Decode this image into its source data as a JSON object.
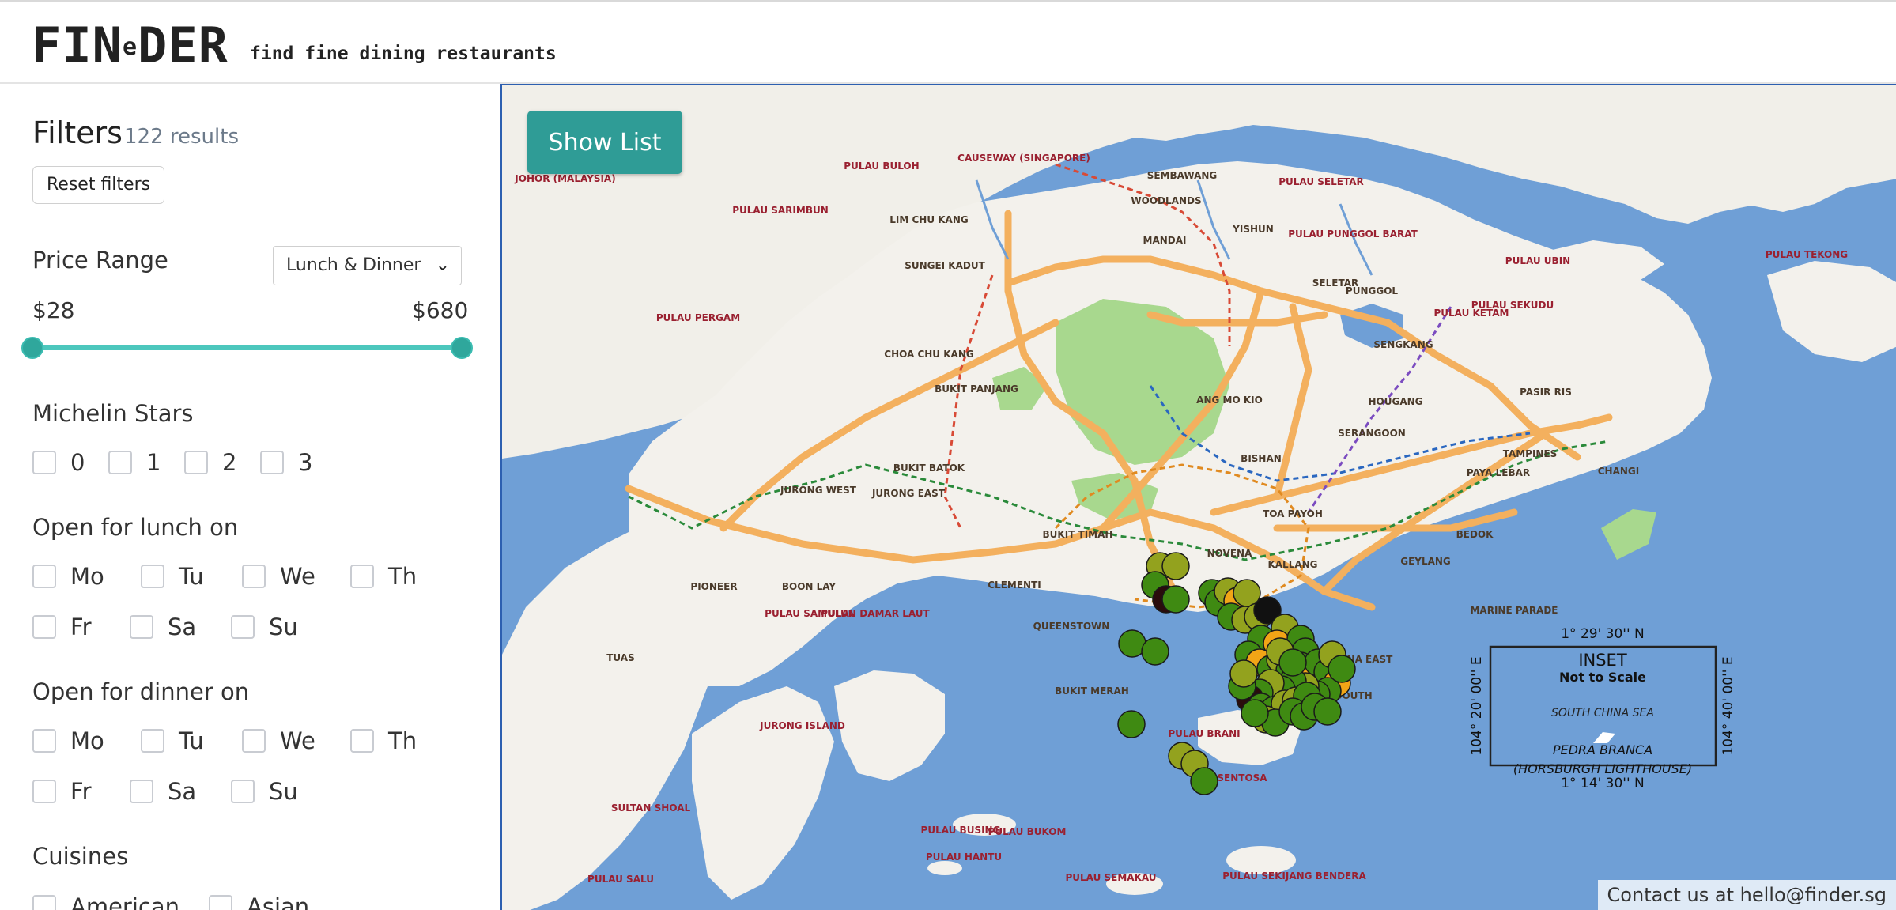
{
  "header": {
    "logo_prefix": "FIN",
    "logo_super": "e",
    "logo_suffix": "DER",
    "tagline": "find fine dining restaurants"
  },
  "filters": {
    "title": "Filters",
    "results": "122 results",
    "reset_label": "Reset filters",
    "price": {
      "label": "Price Range",
      "meal_select": "Lunch & Dinner",
      "min_label": "$28",
      "max_label": "$680"
    },
    "stars": {
      "label": "Michelin Stars",
      "options": [
        "0",
        "1",
        "2",
        "3"
      ]
    },
    "lunch": {
      "label": "Open for lunch on",
      "days": [
        "Mo",
        "Tu",
        "We",
        "Th",
        "Fr",
        "Sa",
        "Su"
      ]
    },
    "dinner": {
      "label": "Open for dinner on",
      "days": [
        "Mo",
        "Tu",
        "We",
        "Th",
        "Fr",
        "Sa",
        "Su"
      ]
    },
    "cuisines": {
      "label": "Cuisines",
      "options": [
        "American",
        "Asian"
      ]
    }
  },
  "map": {
    "show_list_label": "Show List",
    "contact": "Contact us at hello@finder.sg",
    "inset": {
      "title": "INSET",
      "subtitle": "Not to Scale",
      "sea": "SOUTH CHINA SEA",
      "place_line1": "PEDRA BRANCA",
      "place_line2": "(HORSBURGH LIGHTHOUSE)",
      "lat_top": "1° 29' 30'' N",
      "lat_bottom": "1° 14' 30'' N",
      "lon_left": "104° 20' 00'' E",
      "lon_right": "104° 40' 00'' E"
    },
    "labels": [
      "WOODLANDS",
      "SEMBAWANG",
      "YISHUN",
      "MANDAI",
      "LIM CHU KANG",
      "SUNGEI KADUT",
      "SELETAR",
      "PUNGGOL",
      "SENGKANG",
      "CHOA CHU KANG",
      "BUKIT PANJANG",
      "ANG MO KIO",
      "HOUGANG",
      "SERANGOON",
      "PASIR RIS",
      "TAMPINES",
      "PAYA LEBAR",
      "BISHAN",
      "BUKIT BATOK",
      "JURONG WEST",
      "JURONG EAST",
      "BUKIT TIMAH",
      "NOVENA",
      "TOA PAYOH",
      "BEDOK",
      "CHANGI",
      "GEYLANG",
      "KALLANG",
      "CLEMENTI",
      "PIONEER",
      "BOON LAY",
      "QUEENSTOWN",
      "MARINE PARADE",
      "BUKIT MERAH",
      "TUAS",
      "MARINA SOUTH",
      "MARINA EAST",
      "PULAU UBIN",
      "PULAU TEKONG",
      "PULAU BRANI",
      "SENTOSA",
      "JOHOR (MALAYSIA)",
      "CAUSEWAY (SINGAPORE)",
      "JURONG ISLAND",
      "SULTAN SHOAL",
      "PULAU SALU",
      "PULAU BUSING",
      "PULAU BUKOM",
      "PULAU HANTU",
      "PULAU SEMAKAU",
      "PULAU SAMULUN",
      "PULAU DAMAR LAUT",
      "PULAU PERGAM",
      "PULAU SARIMBUN",
      "PULAU BULOH",
      "PULAU SELETAR",
      "PULAU PUNGGOL BARAT",
      "PULAU KETAM",
      "PULAU SEKUDU",
      "PULAU SEKIJANG BENDERA"
    ],
    "markers": {
      "colors": {
        "green": "#3f8a12",
        "olive": "#93a21e",
        "orange": "#f2a516",
        "dark": "#2a0c0c",
        "black": "#111111"
      }
    }
  }
}
